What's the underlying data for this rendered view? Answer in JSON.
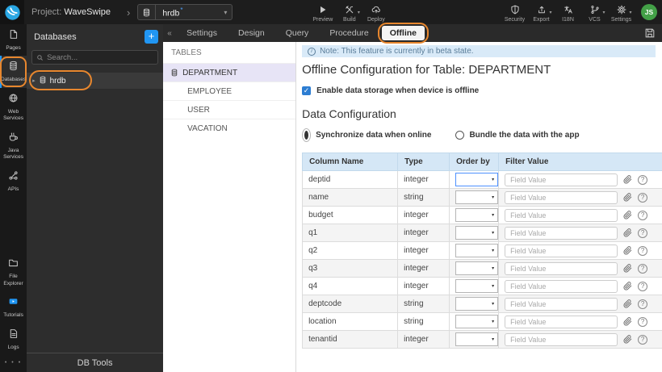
{
  "glyphs": {
    "breadcrumb_chevron": "›",
    "dropdown_caret": "▾",
    "collapse": "«",
    "expand_caret": "▸",
    "more_dots": "• • •",
    "check": "✓",
    "question": "?",
    "info": "i",
    "plus": "+",
    "modified_star": "*"
  },
  "colors": {
    "accent_blue": "#2196f3",
    "annotation_orange": "#e8872e",
    "avatar_green": "#43a047",
    "table_header_blue": "#d5e7f6",
    "note_blue_bg": "#d9eaf8",
    "selected_lavender": "#e7e4f6",
    "focus_blue": "#4d90fe"
  },
  "topbar": {
    "project_prefix": "Project:",
    "project_name": "WaveSwipe",
    "db_selector": {
      "value": "hrdb"
    },
    "actions_left": [
      {
        "label": "Preview",
        "icon": "play",
        "caret": false
      },
      {
        "label": "Build",
        "icon": "tools",
        "caret": true
      },
      {
        "label": "Deploy",
        "icon": "cloud-upload",
        "caret": false
      }
    ],
    "actions_right": [
      {
        "label": "Security",
        "icon": "shield",
        "caret": false
      },
      {
        "label": "Export",
        "icon": "export",
        "caret": true
      },
      {
        "label": "I18N",
        "icon": "translate",
        "caret": false
      },
      {
        "label": "VCS",
        "icon": "branch",
        "caret": true
      },
      {
        "label": "Settings",
        "icon": "gear",
        "caret": true
      }
    ],
    "avatar_initials": "JS"
  },
  "sidebar": {
    "top": [
      {
        "label": "Pages",
        "icon": "pages",
        "active": false,
        "annotated": false
      },
      {
        "label": "Databases",
        "icon": "database",
        "active": true,
        "annotated": true
      },
      {
        "label": "Web Services",
        "icon": "globe",
        "active": false,
        "annotated": false
      },
      {
        "label": "Java Services",
        "icon": "coffee",
        "active": false,
        "annotated": false
      },
      {
        "label": "APIs",
        "icon": "api",
        "active": false,
        "annotated": false
      }
    ],
    "bottom": [
      {
        "label": "File Explorer",
        "icon": "folder",
        "active": false,
        "annotated": false
      },
      {
        "label": "Tutorials",
        "icon": "video",
        "active": false,
        "annotated": false
      },
      {
        "label": "Logs",
        "icon": "logs",
        "active": false,
        "annotated": false
      }
    ]
  },
  "db_panel": {
    "title": "Databases",
    "search_placeholder": "Search...",
    "items": [
      {
        "label": "hrdb",
        "annotated": true
      }
    ],
    "footer": "DB Tools"
  },
  "tab_bar": {
    "tabs": [
      {
        "label": "Settings",
        "active": false,
        "annotated": false
      },
      {
        "label": "Design",
        "active": false,
        "annotated": false
      },
      {
        "label": "Query",
        "active": false,
        "annotated": false
      },
      {
        "label": "Procedure",
        "active": false,
        "annotated": false
      },
      {
        "label": "Offline",
        "active": true,
        "annotated": true
      }
    ]
  },
  "tables_panel": {
    "title": "TABLES",
    "items": [
      {
        "label": "DEPARTMENT",
        "selected": true
      },
      {
        "label": "EMPLOYEE",
        "selected": false
      },
      {
        "label": "USER",
        "selected": false
      },
      {
        "label": "VACATION",
        "selected": false
      }
    ]
  },
  "main": {
    "note": "Note: This feature is currently in beta state.",
    "title": "Offline Configuration for Table: DEPARTMENT",
    "enable_label": "Enable data storage when device is offline",
    "enable_checked": true,
    "section_title": "Data Configuration",
    "radios": [
      {
        "label": "Synchronize data when online",
        "selected": true
      },
      {
        "label": "Bundle the data with the app",
        "selected": false
      }
    ],
    "table": {
      "headers": [
        "Column Name",
        "Type",
        "Order by",
        "Filter Value"
      ],
      "filter_placeholder": "Field Value",
      "rows": [
        {
          "name": "deptid",
          "type": "integer",
          "order_focused": true
        },
        {
          "name": "name",
          "type": "string",
          "order_focused": false
        },
        {
          "name": "budget",
          "type": "integer",
          "order_focused": false
        },
        {
          "name": "q1",
          "type": "integer",
          "order_focused": false
        },
        {
          "name": "q2",
          "type": "integer",
          "order_focused": false
        },
        {
          "name": "q3",
          "type": "integer",
          "order_focused": false
        },
        {
          "name": "q4",
          "type": "integer",
          "order_focused": false
        },
        {
          "name": "deptcode",
          "type": "string",
          "order_focused": false
        },
        {
          "name": "location",
          "type": "string",
          "order_focused": false
        },
        {
          "name": "tenantid",
          "type": "integer",
          "order_focused": false
        }
      ]
    }
  }
}
